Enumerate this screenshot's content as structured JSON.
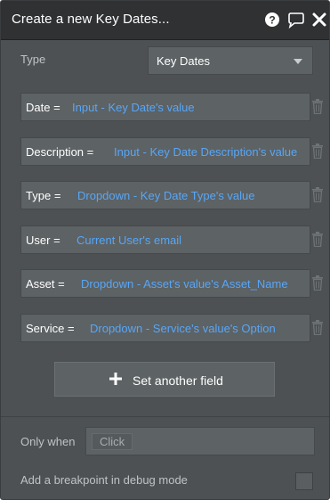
{
  "header": {
    "title": "Create a new Key Dates..."
  },
  "type_row": {
    "label": "Type",
    "value": "Key Dates"
  },
  "fields": [
    {
      "name": "Date",
      "operator": "=",
      "expression": "Input - Key Date's value"
    },
    {
      "name": "Description",
      "operator": "=",
      "expression": "Input - Key Date Description's value"
    },
    {
      "name": "Type",
      "operator": "=",
      "expression": "Dropdown - Key Date Type's value"
    },
    {
      "name": "User",
      "operator": "=",
      "expression": "Current User's email"
    },
    {
      "name": "Asset",
      "operator": "=",
      "expression": "Dropdown - Asset's value's Asset_Name"
    },
    {
      "name": "Service",
      "operator": "=",
      "expression": "Dropdown - Service's value's Option"
    }
  ],
  "add_field_button": {
    "label": "Set another field"
  },
  "only_when": {
    "label": "Only when",
    "placeholder": "Click"
  },
  "breakpoint": {
    "label": "Add a breakpoint in debug mode",
    "checked": false
  },
  "icons": {
    "help": "help-icon",
    "comment": "comment-icon",
    "close": "close-icon",
    "trash": "trash-icon",
    "plus": "plus-icon",
    "dropdown": "chevron-down-icon"
  },
  "colors": {
    "panel_bg": "#4d5153",
    "header_bg": "#2f3133",
    "field_bg": "#5d6264",
    "expression_text": "#58a6f7",
    "label_text": "#ffffff"
  }
}
